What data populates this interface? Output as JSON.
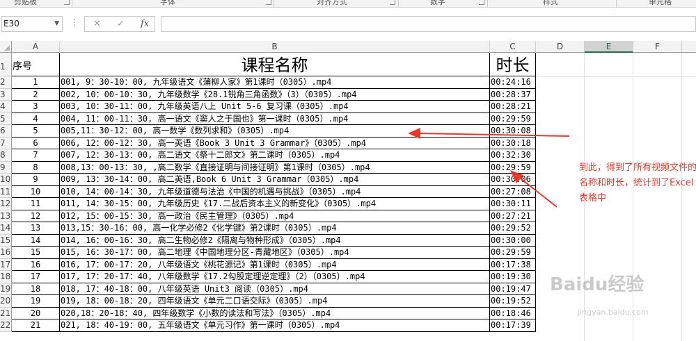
{
  "ribbon": {
    "groups": [
      "剪贴板",
      "字体",
      "对齐方式",
      "数字",
      "样式",
      "单元格"
    ]
  },
  "formula_bar": {
    "name_box": "E30",
    "cancel_icon": "✕",
    "enter_icon": "✓",
    "fx_label": "fx",
    "formula": ""
  },
  "columns": [
    "A",
    "B",
    "C",
    "D",
    "E",
    "F"
  ],
  "selected_column": "E",
  "header_row": {
    "row": "1",
    "seq": "序号",
    "name": "课程名称",
    "duration": "时长"
  },
  "rows": [
    {
      "row": "2",
      "seq": "1",
      "name": "001, 9：30-10：00, 九年级语文《蒲柳人家》第1课时（0305）.mp4",
      "duration": "00:24:16"
    },
    {
      "row": "3",
      "seq": "2",
      "name": "002, 10：00-10：30, 九年级数学《28.1锐角三角函数》（3）（0305）.mp4",
      "duration": "00:28:37"
    },
    {
      "row": "4",
      "seq": "3",
      "name": "003, 10：30-11：00, 九年级英语八上 Unit 5-6  复习课（0305）.mp4",
      "duration": "00:28:21"
    },
    {
      "row": "5",
      "seq": "4",
      "name": "004, 11：00-11：30, 高一语文《窦人之于国也》第一课时（0305）.mp4",
      "duration": "00:29:59"
    },
    {
      "row": "6",
      "seq": "5",
      "name": "005,11：30-12：00, 高一数学《数列求和》（0305）.mp4",
      "duration": "00:30:08"
    },
    {
      "row": "7",
      "seq": "6",
      "name": "006, 12：00-12：30, 高一英语《Book 3 Unit 3 Grammar》（0305）.mp4",
      "duration": "00:30:18"
    },
    {
      "row": "8",
      "seq": "7",
      "name": "007, 12：30-13：00, 高二语文《祭十二郎文》第二课时（0305）.mp4",
      "duration": "00:32:30"
    },
    {
      "row": "9",
      "seq": "8",
      "name": "008,13：00-13：30, ,高二数学《直接证明与间接证明》第1课时（0305）.mp4",
      "duration": "00:29:59"
    },
    {
      "row": "10",
      "seq": "9",
      "name": "009, 13：30-14：00, 高二英语,Book 6 Unit 3 Grammar（0305）.mp4",
      "duration": "00:30:06"
    },
    {
      "row": "11",
      "seq": "10",
      "name": "010, 14：00-14：30, 九年级道德与法治《中国的机遇与挑战》（0305）.mp4",
      "duration": "00:27:08"
    },
    {
      "row": "12",
      "seq": "11",
      "name": "011, 14：30-15：00,  九年级历史《17.二战后资本主义的新变化》（0305）.mp4",
      "duration": "00:30:11"
    },
    {
      "row": "13",
      "seq": "12",
      "name": "012, 15：00-15：30, 高一政治《民主管理》（0305）.mp4",
      "duration": "00:27:21"
    },
    {
      "row": "14",
      "seq": "13",
      "name": "013,15：30-16：00, 高一化学必修2《化学键》第2课时（0305）.mp4",
      "duration": "00:29:52"
    },
    {
      "row": "15",
      "seq": "14",
      "name": "014, 16：00-16：30, 高二生物必修2《隔离与物种形成》（0305）.mp4",
      "duration": "00:30:00"
    },
    {
      "row": "16",
      "seq": "15",
      "name": "015, 16：30-17：00, 高二地理《中国地理分区-青藏地区》（0305）.mp4",
      "duration": "00:29:59"
    },
    {
      "row": "17",
      "seq": "16",
      "name": "016, 17：00-17：20, 八年级语文《桃花源记》第1课时（0305）.mp4",
      "duration": "00:17:38"
    },
    {
      "row": "18",
      "seq": "17",
      "name": "017, 17：20-17：40, 八年级数学《17.2勾股定理逆定理》（2）（0305）.mp4",
      "duration": "00:19:30"
    },
    {
      "row": "19",
      "seq": "18",
      "name": "018, 17：40-18：00, 八年级英语 Unit3 阅读（0305）.mp4",
      "duration": "00:19:47"
    },
    {
      "row": "20",
      "seq": "19",
      "name": "019, 18：00-18：20, 四年级语文《单元二口语交际》（0305）.mp4",
      "duration": "00:19:52"
    },
    {
      "row": "21",
      "seq": "20",
      "name": "020,18：20-18：40, 四年级数学《小数的读法和写法》（0305）.mp4",
      "duration": "00:18:46"
    },
    {
      "row": "22",
      "seq": "21",
      "name": "021, 18：40-19：00, 五年级语文《单元习作》第一课时（0305）.mp4",
      "duration": "00:17:39"
    }
  ],
  "annotation": {
    "text": "到此，得到了所有视频文件的名称和时长，统计到了Excel表格中",
    "color": "#e8382b"
  },
  "watermark": {
    "brand": "Baidu经验",
    "url": "jingyan.baidu.com"
  },
  "colors": {
    "accent": "#217346",
    "arrow": "#e8382b"
  }
}
